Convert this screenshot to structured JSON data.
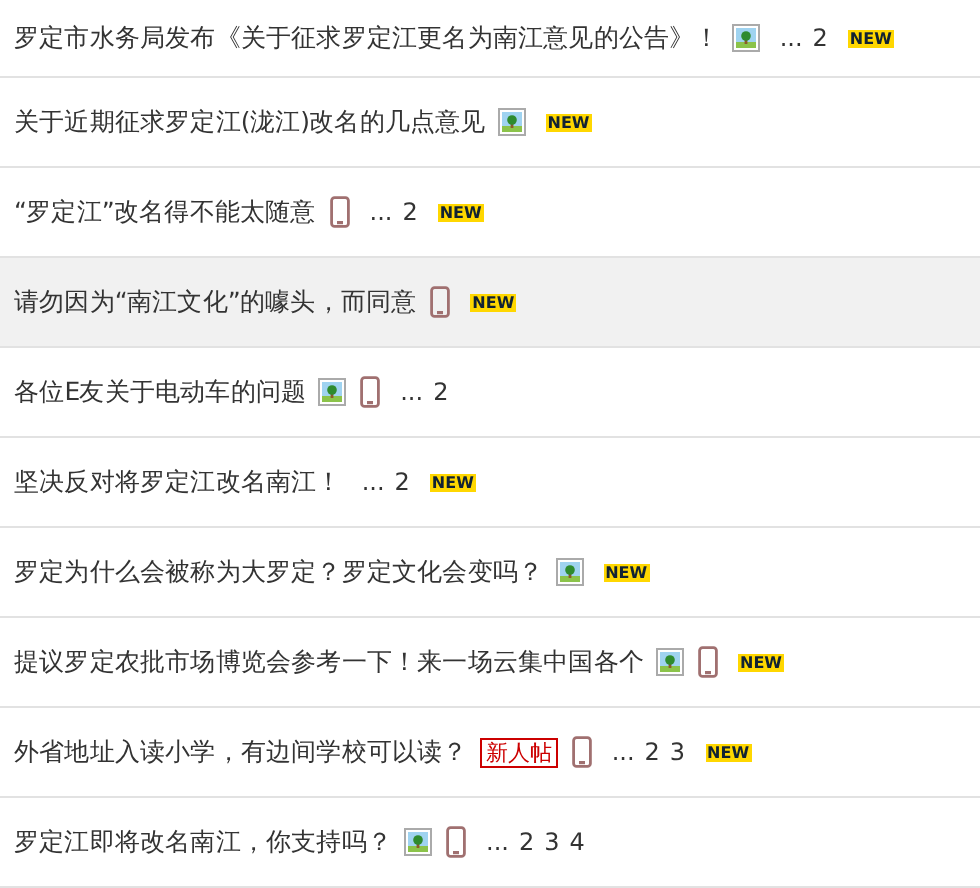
{
  "threads": [
    {
      "title": "罗定市水务局发布《关于征求罗定江更名为南江意见的公告》！",
      "image": true,
      "mobile": false,
      "pages": [
        "2"
      ],
      "new": "NEW",
      "highlighted": false
    },
    {
      "title": "关于近期征求罗定江(泷江)改名的几点意见",
      "image": true,
      "mobile": false,
      "new": "NEW",
      "highlighted": false
    },
    {
      "title": "“罗定江”改名得不能太随意",
      "image": false,
      "mobile": true,
      "pages": [
        "2"
      ],
      "new": "NEW",
      "highlighted": false
    },
    {
      "title": "请勿因为“南江文化”的噱头，而同意",
      "image": false,
      "mobile": true,
      "new": "NEW",
      "highlighted": true
    },
    {
      "title": "各位E友关于电动车的问题",
      "image": true,
      "mobile": true,
      "pages": [
        "2"
      ],
      "highlighted": false
    },
    {
      "title": "坚决反对将罗定江改名南江！",
      "image": false,
      "mobile": false,
      "pages": [
        "2"
      ],
      "new": "NEW",
      "highlighted": false
    },
    {
      "title": "罗定为什么会被称为大罗定？罗定文化会变吗？",
      "image": true,
      "mobile": false,
      "new": "NEW",
      "highlighted": false
    },
    {
      "title": "提议罗定农批市场博览会参考一下！来一场云集中国各个",
      "image": true,
      "mobile": true,
      "new": "NEW",
      "highlighted": false
    },
    {
      "title": "外省地址入读小学，有边间学校可以读？",
      "badge": "新人帖",
      "image": false,
      "mobile": true,
      "pages": [
        "2",
        "3"
      ],
      "new": "NEW",
      "highlighted": false
    },
    {
      "title": "罗定江即将改名南江，你支持吗？",
      "image": true,
      "mobile": true,
      "pages": [
        "2",
        "3",
        "4"
      ],
      "highlighted": false
    }
  ],
  "ellipsis": "..."
}
